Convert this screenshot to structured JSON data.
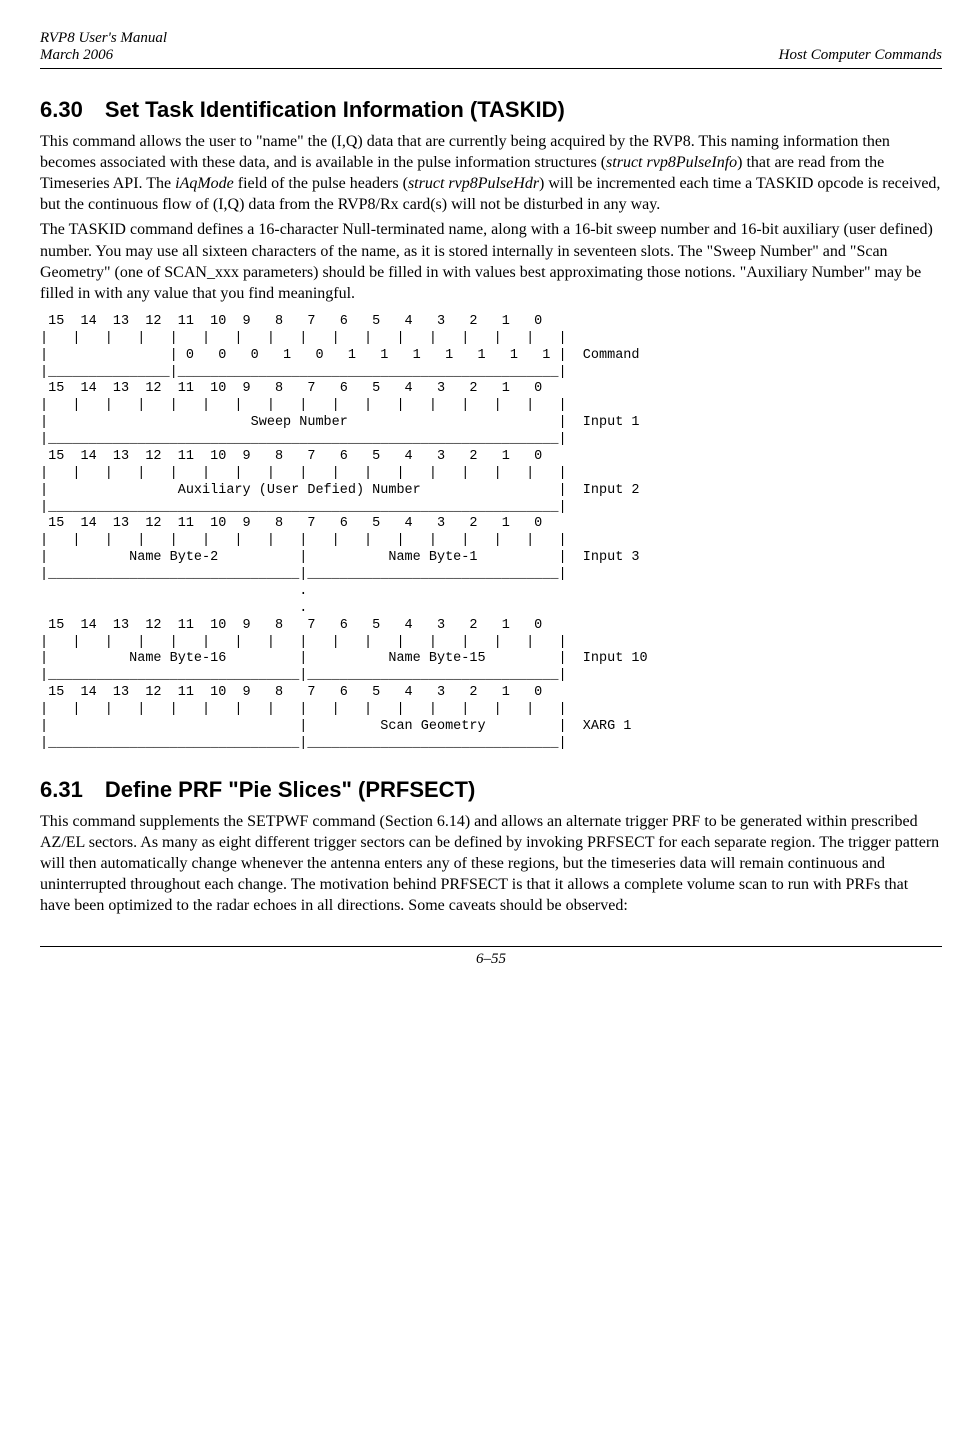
{
  "header": {
    "left1": "RVP8 User's Manual",
    "left2": "March 2006",
    "right": "Host Computer Commands"
  },
  "sec630": {
    "num": "6.30",
    "title": "Set Task Identification Information (TASKID)",
    "p1a": "This command allows the user to \"name\" the (I,Q) data that are currently being acquired by the RVP8.  This naming information then becomes associated with these data, and is available in the pulse information structures (",
    "p1i1": "struct rvp8PulseInfo",
    "p1b": ") that are read from the Timeseries API.  The ",
    "p1i2": "iAqMode",
    "p1c": " field of the pulse headers (",
    "p1i3": "struct rvp8PulseHdr",
    "p1d": ") will be incremented each time a TASKID opcode is received, but the continuous flow of (I,Q) data from the RVP8/Rx card(s) will not be disturbed in any way.",
    "p2": "The TASKID command defines a 16-character Null-terminated name, along with a 16-bit sweep number and 16-bit auxiliary (user defined) number.  You may use all sixteen characters of the name, as it is stored internally in seventeen slots.  The \"Sweep Number\" and \"Scan Geometry\" (one of SCAN_xxx parameters) should be filled in with values best approximating those notions. \"Auxiliary Number\" may be filled in with any value that you find meaningful."
  },
  "diagram": {
    "bits": " 15  14  13  12  11  10  9   8   7   6   5   4   3   2   1   0  ",
    "tick": "|   |   |   |   |   |   |   |   |   |   |   |   |   |   |   |   |",
    "cmd1": "|               | 0   0   0   1   0   1   1   1   1   1   1   1 |  Command",
    "cmd2": "|_______________|_______________________________________________|",
    "in1a": "|                         Sweep Number                          |  Input 1",
    "full": "|_______________________________________________________________|",
    "in2a": "|                Auxiliary (User Defied) Number                 |  Input 2",
    "in3a": "|          Name Byte-2          |          Name Byte-1          |  Input 3",
    "half": "|_______________________________|_______________________________|",
    "dot": "                                .",
    "in10a": "|          Name Byte-16         |          Name Byte-15         |  Input 10",
    "xargA": "|                               |         Scan Geometry         |  XARG 1"
  },
  "sec631": {
    "num": "6.31",
    "title": "Define PRF \"Pie Slices\" (PRFSECT)",
    "p1": "This command supplements the SETPWF command (Section 6.14) and allows an alternate trigger PRF to be generated within prescribed AZ/EL sectors.  As many as eight different trigger sectors can be defined by invoking PRFSECT for each separate region.  The trigger pattern will then automatically change whenever the antenna enters any of these regions, but the timeseries data will remain continuous and uninterrupted throughout each change.  The motivation behind PRFSECT is that it allows a complete volume scan to run with PRFs that have been optimized to the radar echoes in all directions.  Some caveats should be observed:"
  },
  "footer": {
    "page": "6–55"
  }
}
